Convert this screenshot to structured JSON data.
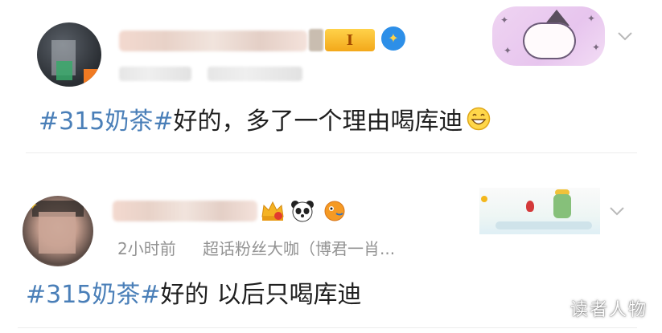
{
  "colors": {
    "hashtag": "#4a7fb8",
    "body_text": "#1f1f1f",
    "meta_text": "#939393",
    "divider": "#ececec",
    "background": "#ffffff"
  },
  "posts": [
    {
      "level_badge": "I",
      "hashtag": "#315奶茶#",
      "body": " 好的，多了一个理由喝库迪",
      "emoji": "grin-emoji",
      "sticker": "witch-cloud-sticker"
    },
    {
      "time": "2小时前",
      "source": "超话粉丝大咖（博君一肖...",
      "hashtag": "#315奶茶#",
      "body_part1": "好的",
      "body_part2": "以后只喝库迪",
      "badge_icons": [
        "crown-icon",
        "panda-icon",
        "fish-icon"
      ],
      "sticker": "little-prince-sticker"
    }
  ],
  "watermark": "读者人物"
}
